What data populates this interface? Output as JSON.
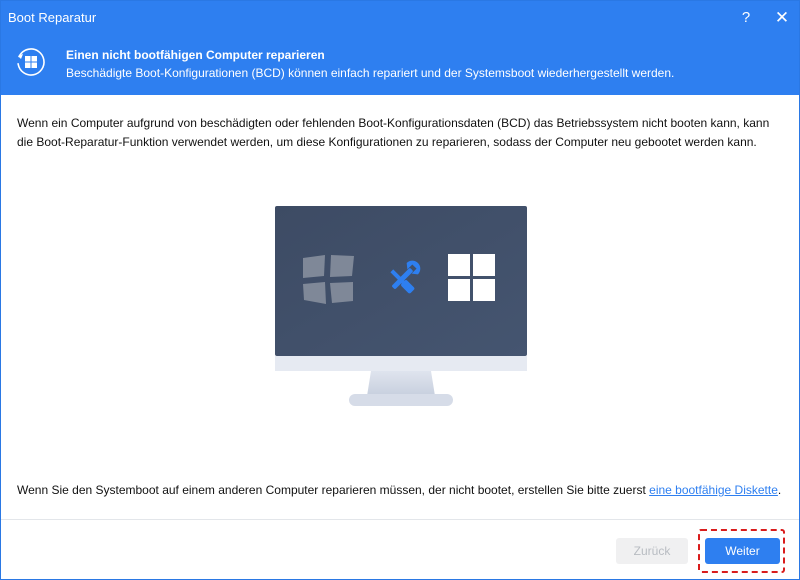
{
  "window": {
    "title": "Boot Reparatur",
    "help_symbol": "?",
    "close_symbol": "✕"
  },
  "header": {
    "icon": "windows-repair-icon",
    "title": "Einen nicht bootfähigen Computer reparieren",
    "subtitle": "Beschädigte Boot-Konfigurationen (BCD) können einfach repariert und der Systemsboot wiederhergestellt werden."
  },
  "main": {
    "description": "Wenn ein Computer aufgrund von beschädigten oder fehlenden Boot-Konfigurationsdaten (BCD) das Betriebssystem nicht booten kann, kann die Boot-Reparatur-Funktion verwendet werden, um diese Konfigurationen zu reparieren, sodass der Computer neu gebootet werden kann.",
    "illustration": {
      "left_icon": "broken-windows-logo-icon",
      "middle_icon": "tools-icon",
      "right_icon": "windows-logo-icon"
    },
    "footnote_text": "Wenn Sie den Systemboot auf einem anderen Computer reparieren müssen, der nicht bootet, erstellen Sie bitte zuerst ",
    "footnote_link": "eine bootfähige Diskette",
    "footnote_end": "."
  },
  "footer": {
    "back_label": "Zurück",
    "next_label": "Weiter"
  },
  "colors": {
    "accent": "#2e7ff0",
    "highlight": "#d91c1c"
  }
}
